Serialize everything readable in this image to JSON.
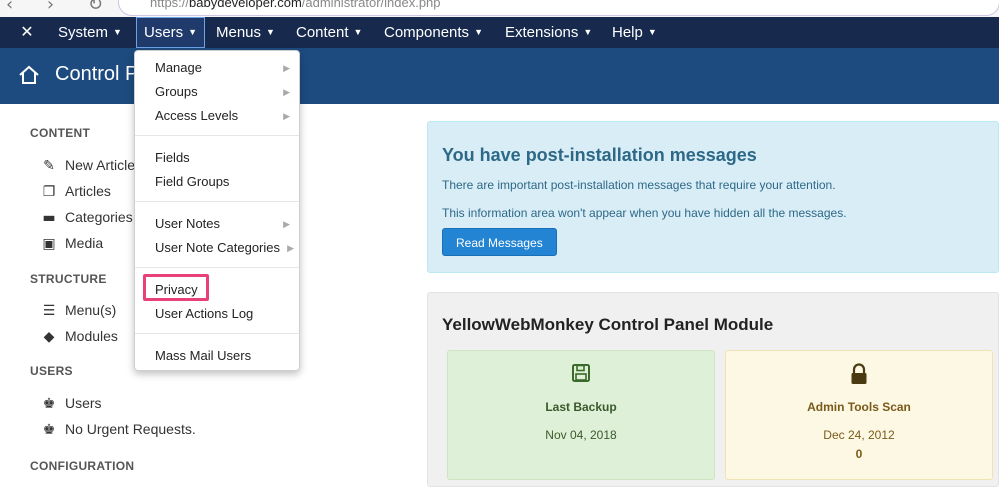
{
  "browser": {
    "url_prefix": "https://",
    "url_domain": "babydeveloper.com",
    "url_path": "/administrator/index.php"
  },
  "navbar": {
    "logo_icon": "joomla-icon",
    "items": [
      {
        "label": "System"
      },
      {
        "label": "Users"
      },
      {
        "label": "Menus"
      },
      {
        "label": "Content"
      },
      {
        "label": "Components"
      },
      {
        "label": "Extensions"
      },
      {
        "label": "Help"
      }
    ]
  },
  "subheader": {
    "title": "Control Panel",
    "icon": "home-icon"
  },
  "sidebar": {
    "sections": [
      {
        "title": "CONTENT",
        "items": [
          "New Article",
          "Articles",
          "Categories",
          "Media"
        ]
      },
      {
        "title": "STRUCTURE",
        "items": [
          "Menu(s)",
          "Modules"
        ]
      },
      {
        "title": "USERS",
        "items": [
          "Users",
          "No Urgent Requests."
        ]
      },
      {
        "title": "CONFIGURATION",
        "items": []
      }
    ]
  },
  "users_menu": {
    "items": [
      {
        "label": "Manage",
        "submenu": true
      },
      {
        "label": "Groups",
        "submenu": true
      },
      {
        "label": "Access Levels",
        "submenu": true
      },
      {
        "label": "Fields",
        "submenu": false
      },
      {
        "label": "Field Groups",
        "submenu": false
      },
      {
        "label": "User Notes",
        "submenu": true
      },
      {
        "label": "User Note Categories",
        "submenu": true
      },
      {
        "label": "Privacy",
        "submenu": false
      },
      {
        "label": "User Actions Log",
        "submenu": false
      },
      {
        "label": "Mass Mail Users",
        "submenu": false
      }
    ],
    "highlight_color": "#e8417a"
  },
  "alert": {
    "heading": "You have post-installation messages",
    "line1": "There are important post-installation messages that require your attention.",
    "line2": "This information area won't appear when you have hidden all the messages.",
    "button": "Read Messages"
  },
  "module": {
    "title": "YellowWebMonkey Control Panel Module",
    "cards": [
      {
        "icon": "floppy-disk-icon",
        "title": "Last Backup",
        "value": "Nov 04, 2018",
        "extra": ""
      },
      {
        "icon": "lock-icon",
        "title": "Admin Tools Scan",
        "value": "Dec 24, 2012",
        "extra": "0"
      }
    ]
  },
  "colors": {
    "navbar": "#172a4e",
    "subheader": "#1d4b7f",
    "alert_bg": "#d9edf7",
    "button": "#2384d3"
  }
}
